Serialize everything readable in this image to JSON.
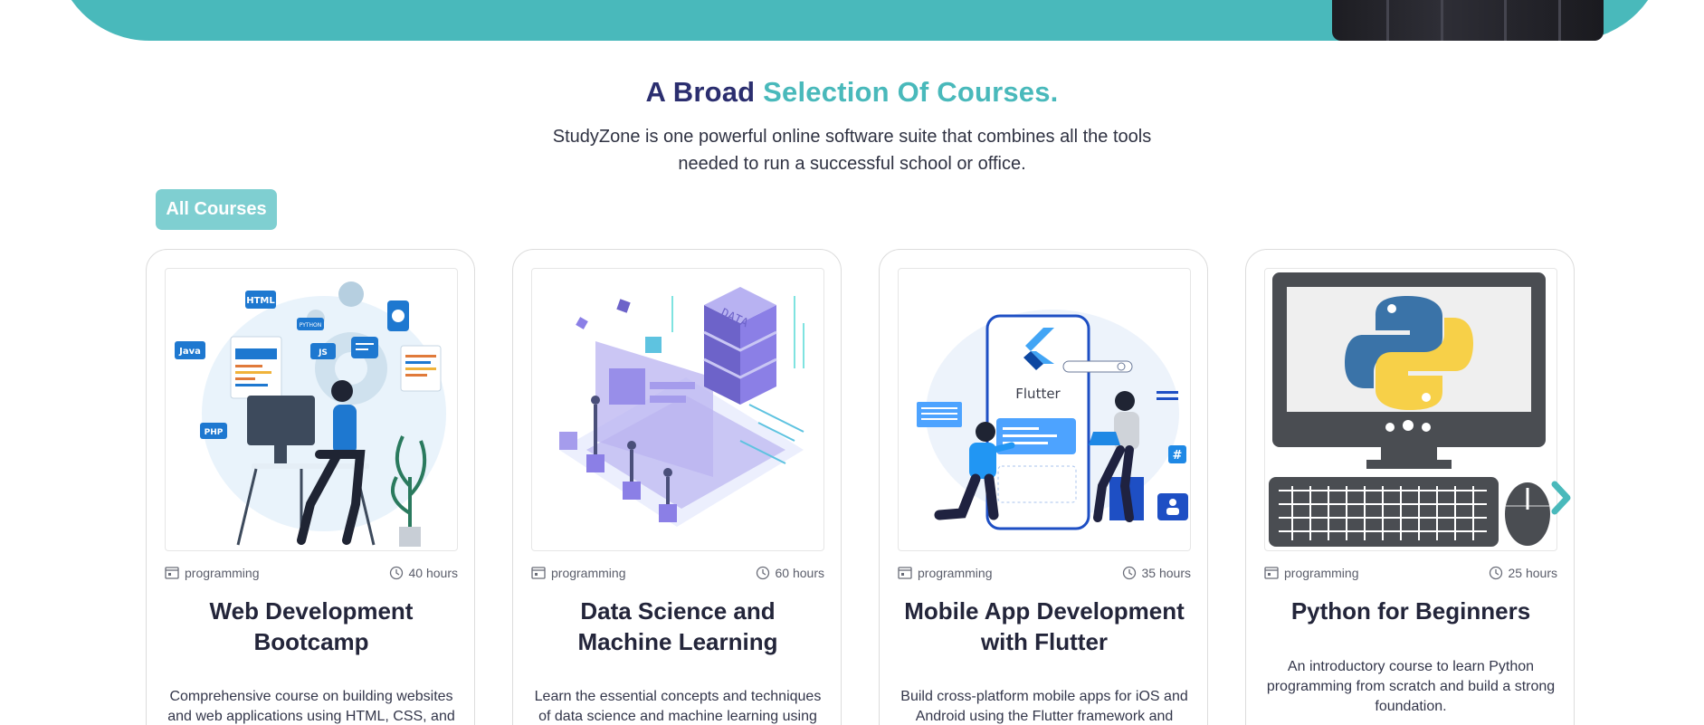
{
  "section": {
    "title_part1": "A Broad",
    "title_part2": "Selection Of Courses.",
    "subtitle": "StudyZone is one powerful online software suite that combines all the tools needed to run a successful school or office."
  },
  "filter": {
    "label": "All Courses"
  },
  "colors": {
    "teal": "#49b9bb",
    "navy": "#2b2e6f",
    "button": "#7fcfd1"
  },
  "courses": [
    {
      "category": "programming",
      "duration": "40 hours",
      "title": "Web Development Bootcamp",
      "description": "Comprehensive course on building websites and web applications using HTML, CSS, and"
    },
    {
      "category": "programming",
      "duration": "60 hours",
      "title": "Data Science and Machine Learning",
      "description": "Learn the essential concepts and techniques of data science and machine learning using"
    },
    {
      "category": "programming",
      "duration": "35 hours",
      "title": "Mobile App Development with Flutter",
      "description": "Build cross-platform mobile apps for iOS and Android using the Flutter framework and"
    },
    {
      "category": "programming",
      "duration": "25 hours",
      "title": "Python for Beginners",
      "description": "An introductory course to learn Python programming from scratch and build a strong foundation."
    }
  ],
  "illustration_labels": {
    "html": "HTML",
    "java": "Java",
    "python_tag": "PYTHON",
    "js": "JS",
    "php": "PHP",
    "data": "DATA",
    "flutter": "Flutter",
    "hash": "#"
  },
  "icons": {
    "category": "category-icon",
    "duration": "clock-icon",
    "prev": "chevron-left-icon",
    "next": "chevron-right-icon"
  }
}
